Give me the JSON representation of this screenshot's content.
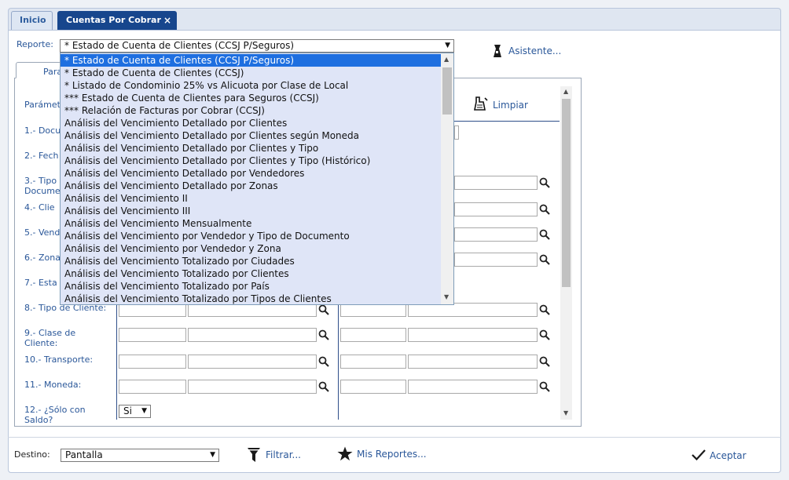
{
  "tabs": [
    {
      "label": "Inicio"
    },
    {
      "label": "Cuentas Por Cobrar",
      "close": "×"
    }
  ],
  "report": {
    "label": "Reporte:",
    "selected": "* Estado de Cuenta de Clientes (CCSJ P/Seguros)",
    "assistant_label": "Asistente..."
  },
  "subtab_label": "Para",
  "params_header": "Parámet",
  "clear_label": "Limpiar",
  "params": [
    {
      "label": "1.- Docu"
    },
    {
      "label": "2.- Fech"
    },
    {
      "label": "3.- Tipo",
      "label2": "Docume"
    },
    {
      "label": "4.- Clie"
    },
    {
      "label": "5.- Vend"
    },
    {
      "label": "6.- Zona"
    },
    {
      "label": "7.- Esta"
    },
    {
      "label": "8.- Tipo de Cliente:"
    },
    {
      "label": "9.- Clase de",
      "label2": "Cliente:"
    },
    {
      "label": "10.- Transporte:"
    },
    {
      "label": "11.- Moneda:"
    },
    {
      "label": "12.- ¿Sólo con",
      "label2": "Saldo?"
    }
  ],
  "saldo_select": "Si",
  "dropdown_items": [
    "* Estado de Cuenta de Clientes (CCSJ P/Seguros)",
    "* Estado de Cuenta de Clientes (CCSJ)",
    "* Listado de Condominio 25% vs Alicuota por Clase de Local",
    "*** Estado de Cuenta de Clientes para Seguros (CCSJ)",
    "*** Relación de Facturas por Cobrar (CCSJ)",
    "Análisis del Vencimiento Detallado por Clientes",
    "Análisis del Vencimiento Detallado por Clientes según Moneda",
    "Análisis del Vencimiento Detallado por Clientes y Tipo",
    "Análisis del Vencimiento Detallado por Clientes y Tipo (Histórico)",
    "Análisis del Vencimiento Detallado por Vendedores",
    "Análisis del Vencimiento Detallado por Zonas",
    "Análisis del Vencimiento II",
    "Análisis del Vencimiento III",
    "Análisis del Vencimiento Mensualmente",
    "Análisis del Vencimiento por Vendedor y Tipo de Documento",
    "Análisis del Vencimiento por Vendedor y Zona",
    "Análisis del Vencimiento Totalizado por Ciudades",
    "Análisis del Vencimiento Totalizado por Clientes",
    "Análisis del Vencimiento Totalizado por País",
    "Análisis del Vencimiento Totalizado por Tipos de Clientes"
  ],
  "footer": {
    "destino_label": "Destino:",
    "destino_value": "Pantalla",
    "filter_label": "Filtrar...",
    "my_reports_label": "Mis Reportes...",
    "accept_label": "Aceptar"
  },
  "colors": {
    "tab_active": "#17468d",
    "label_blue": "#2a5799",
    "dropdown_bg": "#dfe5f7",
    "selected_item": "#1e6fe0"
  }
}
